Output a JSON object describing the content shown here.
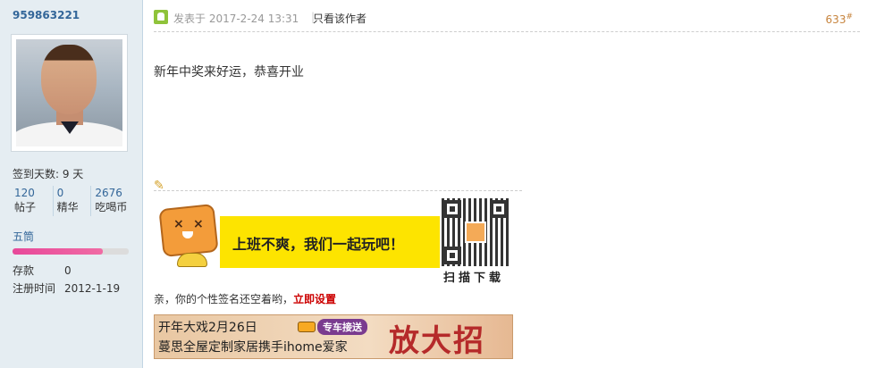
{
  "profile": {
    "username": "959863221",
    "checkin": "签到天数: 9 天",
    "stats": [
      {
        "value": "120",
        "label": "帖子"
      },
      {
        "value": "0",
        "label": "精华"
      },
      {
        "value": "2676",
        "label": "吃喝币"
      }
    ],
    "grade": "五筒",
    "grade_progress": 0.78,
    "deposit_label": "存款",
    "deposit_value": "0",
    "register_label": "注册时间",
    "register_value": "2012-1-19"
  },
  "post": {
    "posted_at": "发表于 2017-2-24 13:31",
    "separator": "|",
    "author_only": "只看该作者",
    "floor_number": "633",
    "floor_suffix": "#",
    "message": "新年中奖来好运，恭喜开业"
  },
  "signature": {
    "banner_text": "上班不爽，我们一起玩吧！",
    "qr_caption": "扫描下载",
    "empty_text": "亲，你的个性签名还空着哟，",
    "setup_link": "立即设置"
  },
  "ad": {
    "line1": "开年大戏2月26日",
    "bus_label": "专车接送",
    "line2": "蔓思全屋定制家居携手ihome爱家",
    "big_text": "放大招"
  },
  "colors": {
    "sidebar_bg": "#e5edf2",
    "link_blue": "#336699",
    "floor_orange": "#c7843d",
    "setup_red": "#cc0000",
    "progress_pink": "#e8489a"
  }
}
